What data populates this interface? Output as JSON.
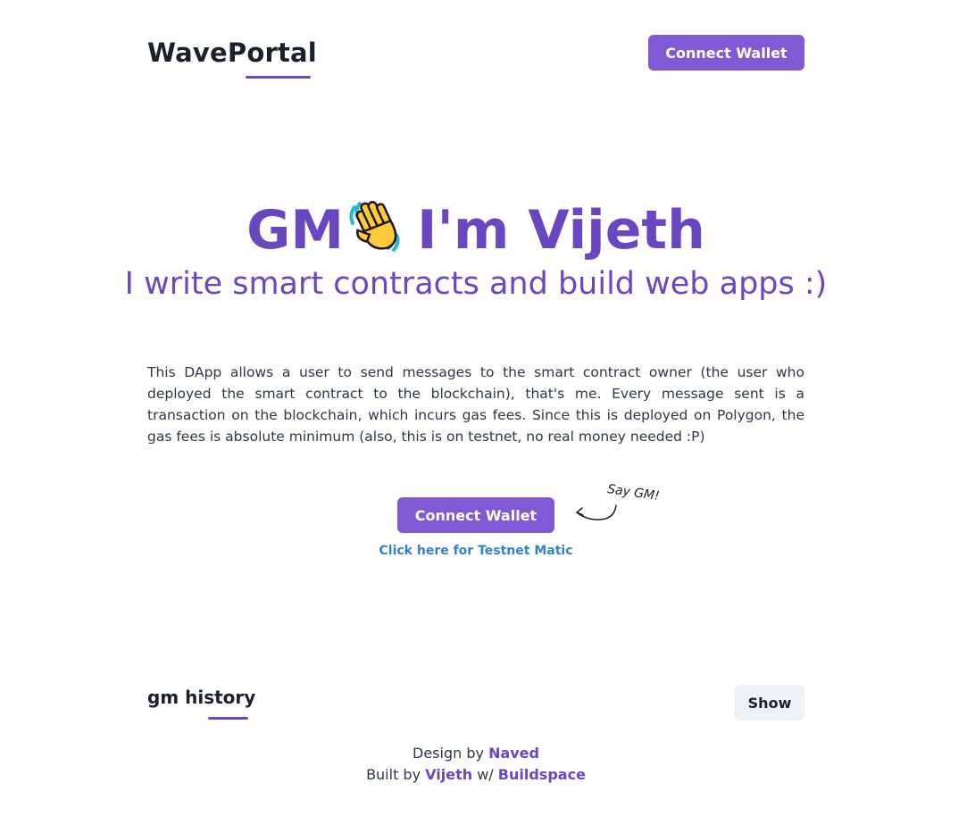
{
  "header": {
    "brand": "WavePortal",
    "connect_label": "Connect Wallet"
  },
  "hero": {
    "title_left": "GM",
    "title_right": "I'm Vijeth",
    "subtitle": "I write smart contracts and build web apps :)"
  },
  "description": "This DApp allows a user to send messages to the smart contract owner (the user who deployed the smart contract to the blockchain), that's me. Every message sent is a transaction on the blockchain, which incurs gas fees. Since this is deployed on Polygon, the gas fees is absolute minimum (also, this is on testnet, no real money needed :P)",
  "cta": {
    "connect_label": "Connect Wallet",
    "note": "Say GM!",
    "faucet_link": "Click here for Testnet Matic"
  },
  "history": {
    "title": "gm history",
    "show_label": "Show"
  },
  "footer": {
    "design_prefix": "Design by",
    "designer": "Naved",
    "built_prefix": "Built by",
    "builder": "Vijeth",
    "with": "w/",
    "platform": "Buildspace"
  },
  "colors": {
    "accent": "#805ad5",
    "heading": "#6b46c1",
    "link": "#3182ce"
  }
}
